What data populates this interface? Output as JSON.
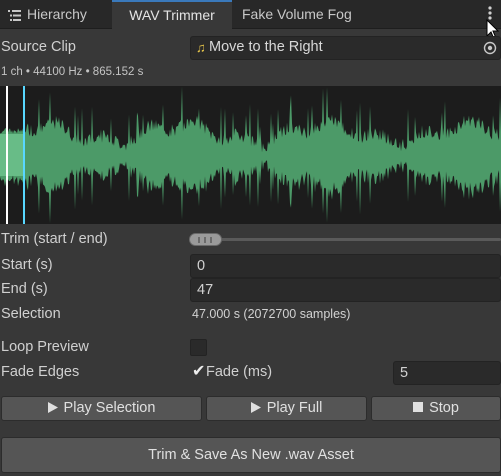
{
  "tabs": [
    {
      "label": "Hierarchy",
      "icon": "hierarchy-list-icon"
    },
    {
      "label": "WAV Trimmer"
    },
    {
      "label": "Fake Volume Fog"
    }
  ],
  "source_clip": {
    "label": "Source Clip",
    "value": "Move to the Right",
    "icon": "audio-clip-icon"
  },
  "clip_info": "1 ch • 44100 Hz • 865.152 s",
  "trim": {
    "label": "Trim (start / end)"
  },
  "start": {
    "label": "Start (s)",
    "value": "0"
  },
  "end": {
    "label": "End (s)",
    "value": "47"
  },
  "selection": {
    "label": "Selection",
    "value": "47.000 s (2072700 samples)"
  },
  "loop_preview": {
    "label": "Loop Preview",
    "checked": false
  },
  "fade_edges": {
    "label": "Fade Edges",
    "checked": true,
    "fade_label": "Fade (ms)",
    "fade_value": "5"
  },
  "buttons": {
    "play_selection": "Play Selection",
    "play_full": "Play Full",
    "stop": "Stop"
  },
  "trim_save": "Trim & Save As New .wav Asset",
  "colors": {
    "accent": "#3a79bb",
    "waveform": "#4c9a68",
    "selection": "#58d7ff"
  }
}
